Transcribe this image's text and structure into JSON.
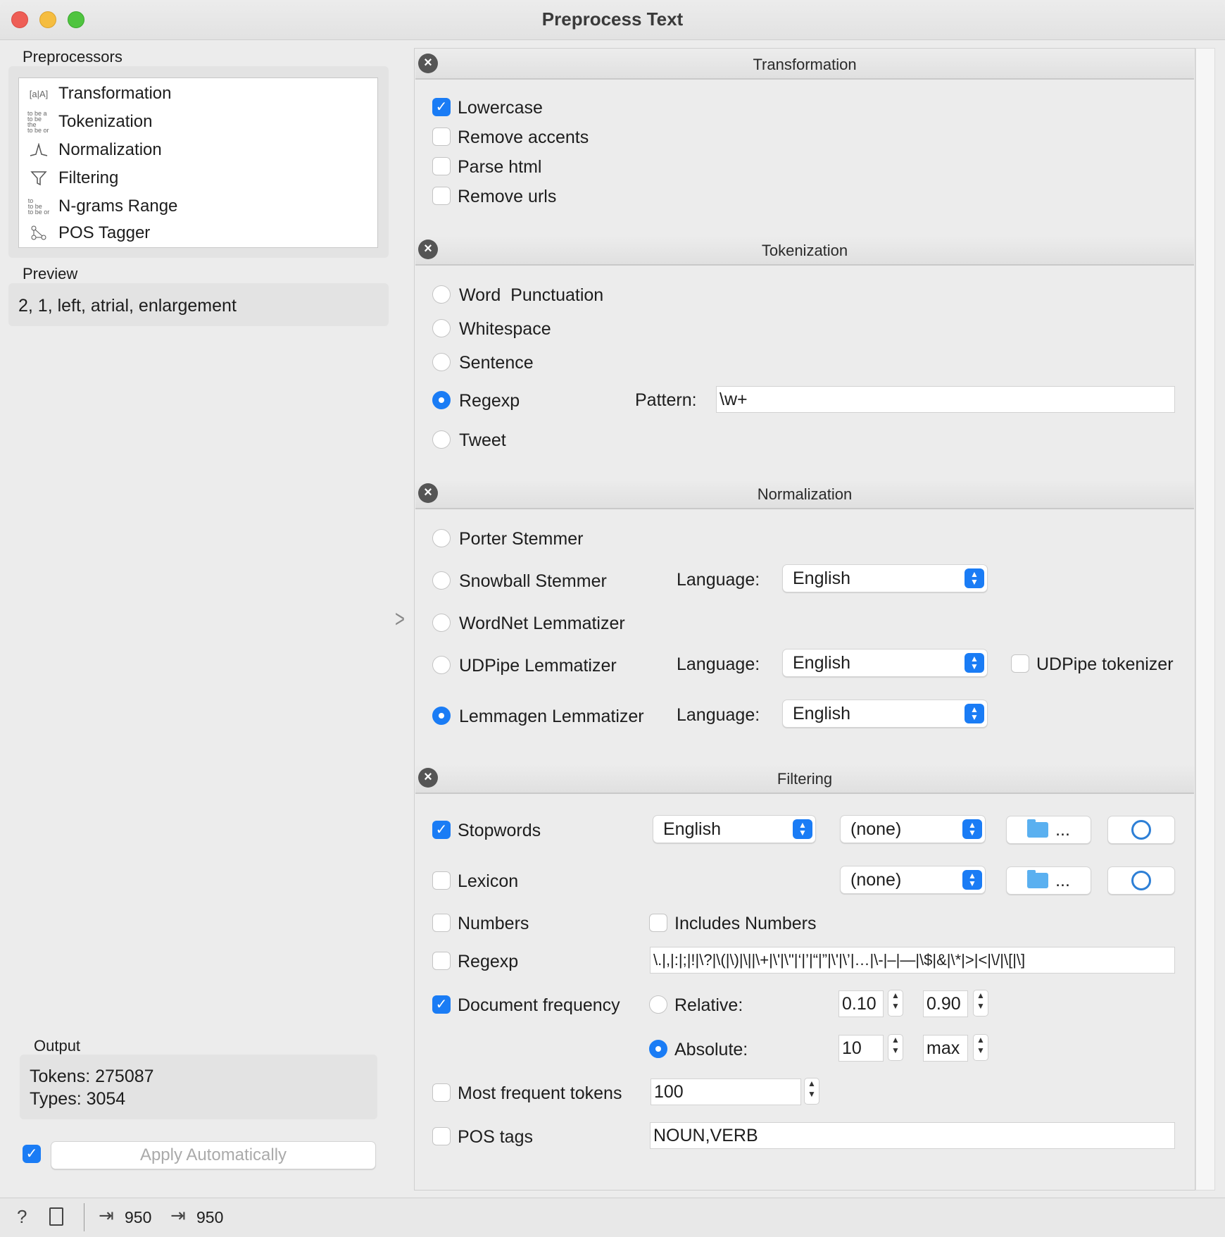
{
  "window": {
    "title": "Preprocess Text"
  },
  "left": {
    "preprocessors_label": "Preprocessors",
    "items": [
      {
        "label": "Transformation",
        "icon": "transformation-icon"
      },
      {
        "label": "Tokenization",
        "icon": "tokenization-icon"
      },
      {
        "label": "Normalization",
        "icon": "normalization-icon"
      },
      {
        "label": "Filtering",
        "icon": "filter-icon"
      },
      {
        "label": "N-grams Range",
        "icon": "ngrams-icon"
      },
      {
        "label": "POS Tagger",
        "icon": "pos-tagger-icon"
      }
    ],
    "preview_label": "Preview",
    "preview_text": "2, 1, left, atrial, enlargement",
    "output_label": "Output",
    "tokens": "Tokens: 275087",
    "types": "Types: 3054",
    "apply_auto_checked": true,
    "apply_label": "Apply Automatically"
  },
  "transformation": {
    "title": "Transformation",
    "options": [
      {
        "label": "Lowercase",
        "checked": true
      },
      {
        "label": "Remove accents",
        "checked": false
      },
      {
        "label": "Parse html",
        "checked": false
      },
      {
        "label": "Remove urls",
        "checked": false
      }
    ]
  },
  "tokenization": {
    "title": "Tokenization",
    "options": [
      "Word  Punctuation",
      "Whitespace",
      "Sentence",
      "Regexp",
      "Tweet"
    ],
    "selected": "Regexp",
    "pattern_label": "Pattern:",
    "pattern_value": "\\w+"
  },
  "normalization": {
    "title": "Normalization",
    "options": [
      "Porter Stemmer",
      "Snowball Stemmer",
      "WordNet Lemmatizer",
      "UDPipe Lemmatizer",
      "Lemmagen Lemmatizer"
    ],
    "selected": "Lemmagen Lemmatizer",
    "language_label": "Language:",
    "snowball_language": "English",
    "udpipe_language": "English",
    "lemmagen_language": "English",
    "udpipe_tokenizer_label": "UDPipe tokenizer",
    "udpipe_tokenizer_checked": false
  },
  "filtering": {
    "title": "Filtering",
    "stopwords_label": "Stopwords",
    "stopwords_checked": true,
    "stopwords_language": "English",
    "stopwords_file": "(none)",
    "lexicon_label": "Lexicon",
    "lexicon_checked": false,
    "lexicon_file": "(none)",
    "browse_label": "...",
    "numbers_label": "Numbers",
    "numbers_checked": false,
    "includes_numbers_label": "Includes Numbers",
    "includes_numbers_checked": false,
    "regexp_label": "Regexp",
    "regexp_checked": false,
    "regexp_value": "\\.|,|:|;|!|\\?|\\(|\\)|\\||\\+|\\'|\\\"|‘|’|“|”|\\'|\\’|…|\\-|–|—|\\$|&|\\*|>|<|\\/|\\[|\\]",
    "docfreq_label": "Document frequency",
    "docfreq_checked": true,
    "relative_label": "Relative:",
    "relative_min": "0.10",
    "relative_max": "0.90",
    "absolute_label": "Absolute:",
    "absolute_min": "10",
    "absolute_max": "max",
    "docfreq_mode": "absolute",
    "most_frequent_label": "Most frequent tokens",
    "most_frequent_checked": false,
    "most_frequent_value": "100",
    "pos_tags_label": "POS tags",
    "pos_tags_checked": false,
    "pos_tags_value": "NOUN,VERB"
  },
  "status": {
    "input_count": "950",
    "output_count": "950"
  },
  "colors": {
    "accent": "#1a7cf5",
    "close_red": "#ee5e56",
    "min_yellow": "#f5bd40",
    "max_green": "#4fc43f"
  }
}
